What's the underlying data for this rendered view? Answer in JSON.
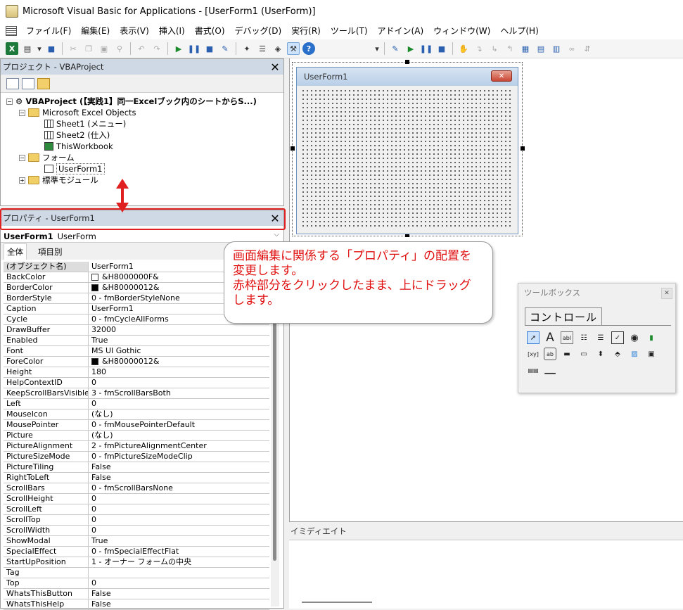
{
  "window": {
    "title": "Microsoft Visual Basic for Applications - [UserForm1 (UserForm)]"
  },
  "menu": [
    "ファイル(F)",
    "編集(E)",
    "表示(V)",
    "挿入(I)",
    "書式(O)",
    "デバッグ(D)",
    "実行(R)",
    "ツール(T)",
    "アドイン(A)",
    "ウィンドウ(W)",
    "ヘルプ(H)"
  ],
  "project": {
    "header": "プロジェクト - VBAProject",
    "root": "VBAProject (【実践1】同一Excelブック内のシートからS...)",
    "excel_objects": "Microsoft Excel Objects",
    "sheet1": "Sheet1 (メニュー)",
    "sheet2": "Sheet2 (仕入)",
    "thisworkbook": "ThisWorkbook",
    "forms": "フォーム",
    "userform1": "UserForm1",
    "modules": "標準モジュール"
  },
  "properties": {
    "header": "プロパティ - UserForm1",
    "object_bold": "UserForm1",
    "object_type": "UserForm",
    "tab_all": "全体",
    "tab_category": "項目別",
    "rows": [
      {
        "name": "(オブジェクト名)",
        "value": "UserForm1"
      },
      {
        "name": "BackColor",
        "value": "&H8000000F&",
        "swatch": "#ffffff"
      },
      {
        "name": "BorderColor",
        "value": "&H80000012&",
        "swatch": "#000000"
      },
      {
        "name": "BorderStyle",
        "value": "0 - fmBorderStyleNone"
      },
      {
        "name": "Caption",
        "value": "UserForm1"
      },
      {
        "name": "Cycle",
        "value": "0 - fmCycleAllForms"
      },
      {
        "name": "DrawBuffer",
        "value": "32000"
      },
      {
        "name": "Enabled",
        "value": "True"
      },
      {
        "name": "Font",
        "value": "MS UI Gothic"
      },
      {
        "name": "ForeColor",
        "value": "&H80000012&",
        "swatch": "#000000"
      },
      {
        "name": "Height",
        "value": "180"
      },
      {
        "name": "HelpContextID",
        "value": "0"
      },
      {
        "name": "KeepScrollBarsVisible",
        "value": "3 - fmScrollBarsBoth"
      },
      {
        "name": "Left",
        "value": "0"
      },
      {
        "name": "MouseIcon",
        "value": "(なし)"
      },
      {
        "name": "MousePointer",
        "value": "0 - fmMousePointerDefault"
      },
      {
        "name": "Picture",
        "value": "(なし)"
      },
      {
        "name": "PictureAlignment",
        "value": "2 - fmPictureAlignmentCenter"
      },
      {
        "name": "PictureSizeMode",
        "value": "0 - fmPictureSizeModeClip"
      },
      {
        "name": "PictureTiling",
        "value": "False"
      },
      {
        "name": "RightToLeft",
        "value": "False"
      },
      {
        "name": "ScrollBars",
        "value": "0 - fmScrollBarsNone"
      },
      {
        "name": "ScrollHeight",
        "value": "0"
      },
      {
        "name": "ScrollLeft",
        "value": "0"
      },
      {
        "name": "ScrollTop",
        "value": "0"
      },
      {
        "name": "ScrollWidth",
        "value": "0"
      },
      {
        "name": "ShowModal",
        "value": "True"
      },
      {
        "name": "SpecialEffect",
        "value": "0 - fmSpecialEffectFlat"
      },
      {
        "name": "StartUpPosition",
        "value": "1 - オーナー フォームの中央"
      },
      {
        "name": "Tag",
        "value": ""
      },
      {
        "name": "Top",
        "value": "0"
      },
      {
        "name": "WhatsThisButton",
        "value": "False"
      },
      {
        "name": "WhatsThisHelp",
        "value": "False"
      }
    ]
  },
  "userform": {
    "caption": "UserForm1",
    "close": "✕"
  },
  "callout": {
    "line1": "画面編集に関係する「プロパティ」の配置を",
    "line2": "変更します。",
    "line3": "赤枠部分をクリックしたまま、上にドラッグ",
    "line4": "します。"
  },
  "toolbox": {
    "header": "ツールボックス",
    "tab": "コントロール",
    "close": "✕"
  },
  "immediate": {
    "header": "イミディエイト"
  },
  "colors": {
    "highlight": "#e02020",
    "pane_header": "#cfd9e5"
  }
}
